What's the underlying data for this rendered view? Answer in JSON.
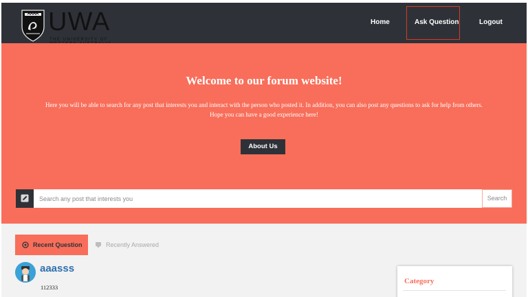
{
  "header": {
    "logo_text": "UWA",
    "logo_subtext": "THE UNIVERSITY OF WESTERN AUSTRALIA",
    "nav": {
      "home": "Home",
      "ask": "Ask Question",
      "logout": "Logout"
    }
  },
  "hero": {
    "title": "Welcome to our forum website!",
    "description_line1": "Here you will be able to search for any post that interests you and interact with the person who posted it. In addition, you can also post any questions to ask for help from others.",
    "description_line2": "Hope you can have a good experience here!",
    "about_button": "About Us"
  },
  "search": {
    "placeholder": "Search any post that interests you",
    "button": "Search"
  },
  "tabs": {
    "recent": "Recent Question",
    "answered": "Recently Answered"
  },
  "question": {
    "title": "aaasss",
    "body": "112333"
  },
  "sidebar": {
    "category_title": "Category"
  },
  "colors": {
    "header_bg": "#2e3238",
    "accent": "#f86e5a",
    "link": "#2f6fae",
    "highlight_border": "#d63b28"
  }
}
